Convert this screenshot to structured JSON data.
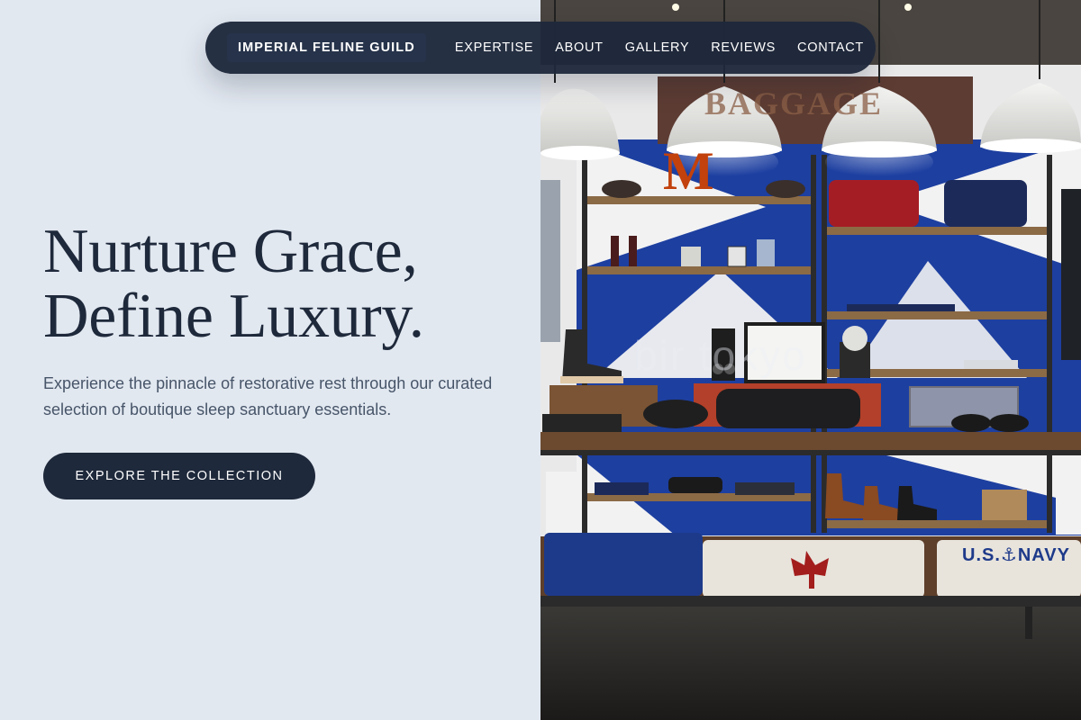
{
  "nav": {
    "brand": "IMPERIAL FELINE GUILD",
    "links": [
      "EXPERTISE",
      "ABOUT",
      "GALLERY",
      "REVIEWS",
      "CONTACT"
    ]
  },
  "hero": {
    "headline_line1": "Nurture Grace,",
    "headline_line2": "Define Luxury.",
    "subtext": "Experience the pinnacle of restorative rest through our curated selection of boutique sleep sanctuary essentials.",
    "cta_label": "EXPLORE THE COLLECTION"
  },
  "photo": {
    "subject": "boutique-store-shelves",
    "watermark": "bir tokyo",
    "sign_text": "BAGGAGE",
    "letter_sign": "M",
    "shirt_text": "U.S.⚓NAVY"
  },
  "colors": {
    "background": "#e2e8f0",
    "primary": "#1e293b",
    "body_text": "#475569",
    "accent_blue": "#1d3fa0"
  }
}
